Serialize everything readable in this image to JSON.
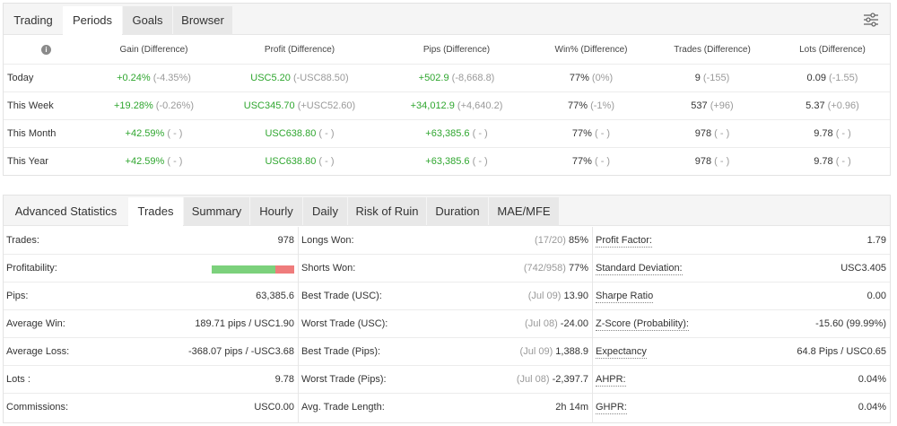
{
  "periods_tabs": [
    {
      "label": "Trading"
    },
    {
      "label": "Periods"
    },
    {
      "label": "Goals"
    },
    {
      "label": "Browser"
    }
  ],
  "periods_table": {
    "info_glyph": "i",
    "columns": [
      "Gain (Difference)",
      "Profit (Difference)",
      "Pips (Difference)",
      "Win% (Difference)",
      "Trades (Difference)",
      "Lots (Difference)"
    ],
    "rows": [
      {
        "label": "Today",
        "gain": {
          "value": "+0.24%",
          "diff": "(-4.35%)"
        },
        "profit": {
          "value": "USC5.20",
          "diff": "(-USC88.50)"
        },
        "pips": {
          "value": "+502.9",
          "diff": "(-8,668.8)"
        },
        "win": {
          "value": "77%",
          "diff": "(0%)"
        },
        "trades": {
          "value": "9",
          "diff": "(-155)"
        },
        "lots": {
          "value": "0.09",
          "diff": "(-1.55)"
        }
      },
      {
        "label": "This Week",
        "gain": {
          "value": "+19.28%",
          "diff": "(-0.26%)"
        },
        "profit": {
          "value": "USC345.70",
          "diff": "(+USC52.60)"
        },
        "pips": {
          "value": "+34,012.9",
          "diff": "(+4,640.2)"
        },
        "win": {
          "value": "77%",
          "diff": "(-1%)"
        },
        "trades": {
          "value": "537",
          "diff": "(+96)"
        },
        "lots": {
          "value": "5.37",
          "diff": "(+0.96)"
        }
      },
      {
        "label": "This Month",
        "gain": {
          "value": "+42.59%",
          "diff": "( - )"
        },
        "profit": {
          "value": "USC638.80",
          "diff": "( - )"
        },
        "pips": {
          "value": "+63,385.6",
          "diff": "( - )"
        },
        "win": {
          "value": "77%",
          "diff": "( - )"
        },
        "trades": {
          "value": "978",
          "diff": "( - )"
        },
        "lots": {
          "value": "9.78",
          "diff": "( - )"
        }
      },
      {
        "label": "This Year",
        "gain": {
          "value": "+42.59%",
          "diff": "( - )"
        },
        "profit": {
          "value": "USC638.80",
          "diff": "( - )"
        },
        "pips": {
          "value": "+63,385.6",
          "diff": "( - )"
        },
        "win": {
          "value": "77%",
          "diff": "( - )"
        },
        "trades": {
          "value": "978",
          "diff": "( - )"
        },
        "lots": {
          "value": "9.78",
          "diff": "( - )"
        }
      }
    ]
  },
  "stats_tabs": [
    {
      "label": "Advanced Statistics"
    },
    {
      "label": "Trades"
    },
    {
      "label": "Summary"
    },
    {
      "label": "Hourly"
    },
    {
      "label": "Daily"
    },
    {
      "label": "Risk of Ruin"
    },
    {
      "label": "Duration"
    },
    {
      "label": "MAE/MFE"
    }
  ],
  "stats_left": [
    {
      "label": "Trades:",
      "value": "978"
    },
    {
      "label": "Profitability:",
      "won_fraction": 0.77
    },
    {
      "label": "Pips:",
      "value": "63,385.6"
    },
    {
      "label": "Average Win:",
      "value": "189.71 pips / USC1.90"
    },
    {
      "label": "Average Loss:",
      "value": "-368.07 pips / -USC3.68"
    },
    {
      "label": "Lots :",
      "value": "9.78"
    },
    {
      "label": "Commissions:",
      "value": "USC0.00"
    }
  ],
  "stats_middle": [
    {
      "label": "Longs Won:",
      "prefix": "(17/20)",
      "value": "85%"
    },
    {
      "label": "Shorts Won:",
      "prefix": "(742/958)",
      "value": "77%"
    },
    {
      "label": "Best Trade (USC):",
      "prefix": "(Jul 09)",
      "value": "13.90"
    },
    {
      "label": "Worst Trade (USC):",
      "prefix": "(Jul 08)",
      "value": "-24.00"
    },
    {
      "label": "Best Trade (Pips):",
      "prefix": "(Jul 09)",
      "value": "1,388.9"
    },
    {
      "label": "Worst Trade (Pips):",
      "prefix": "(Jul 08)",
      "value": "-2,397.7"
    },
    {
      "label": "Avg. Trade Length:",
      "prefix": "",
      "value": "2h 14m"
    }
  ],
  "stats_right": [
    {
      "label": "Profit Factor:",
      "value": "1.79"
    },
    {
      "label": "Standard Deviation:",
      "value": "USC3.405"
    },
    {
      "label": "Sharpe Ratio",
      "value": "0.00"
    },
    {
      "label": "Z-Score (Probability):",
      "value": "-15.60 (99.99%)"
    },
    {
      "label": "Expectancy",
      "value": "64.8 Pips / USC0.65"
    },
    {
      "label": "AHPR:",
      "value": "0.04%"
    },
    {
      "label": "GHPR:",
      "value": "0.04%"
    }
  ],
  "colors": {
    "positive": "#2fa62f",
    "won_bar": "#7cd17c",
    "lost_bar": "#ef7c7c"
  }
}
